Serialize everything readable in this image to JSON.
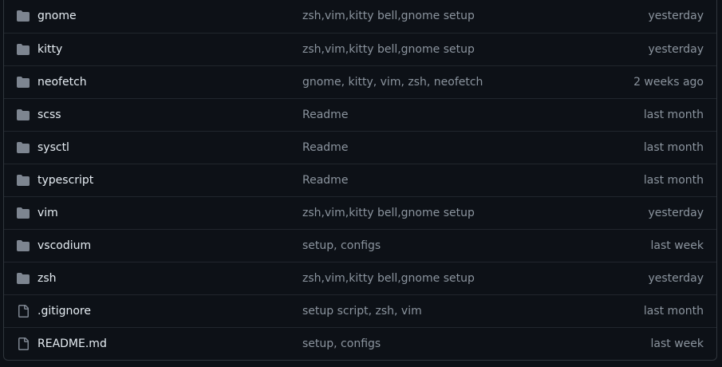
{
  "colors": {
    "background": "#0d1117",
    "border": "#30363d",
    "row_divider": "#21262d",
    "primary_text": "#e6edf3",
    "muted_text": "#8b949e",
    "icon": "#7d8590"
  },
  "files": [
    {
      "icon": "folder-icon",
      "name": "gnome",
      "message": "zsh,vim,kitty bell,gnome setup",
      "time": "yesterday"
    },
    {
      "icon": "folder-icon",
      "name": "kitty",
      "message": "zsh,vim,kitty bell,gnome setup",
      "time": "yesterday"
    },
    {
      "icon": "folder-icon",
      "name": "neofetch",
      "message": "gnome, kitty, vim, zsh, neofetch",
      "time": "2 weeks ago"
    },
    {
      "icon": "folder-icon",
      "name": "scss",
      "message": "Readme",
      "time": "last month"
    },
    {
      "icon": "folder-icon",
      "name": "sysctl",
      "message": "Readme",
      "time": "last month"
    },
    {
      "icon": "folder-icon",
      "name": "typescript",
      "message": "Readme",
      "time": "last month"
    },
    {
      "icon": "folder-icon",
      "name": "vim",
      "message": "zsh,vim,kitty bell,gnome setup",
      "time": "yesterday"
    },
    {
      "icon": "folder-icon",
      "name": "vscodium",
      "message": "setup, configs",
      "time": "last week"
    },
    {
      "icon": "folder-icon",
      "name": "zsh",
      "message": "zsh,vim,kitty bell,gnome setup",
      "time": "yesterday"
    },
    {
      "icon": "file-icon",
      "name": ".gitignore",
      "message": "setup script, zsh, vim",
      "time": "last month"
    },
    {
      "icon": "file-icon",
      "name": "README.md",
      "message": "setup, configs",
      "time": "last week"
    }
  ]
}
